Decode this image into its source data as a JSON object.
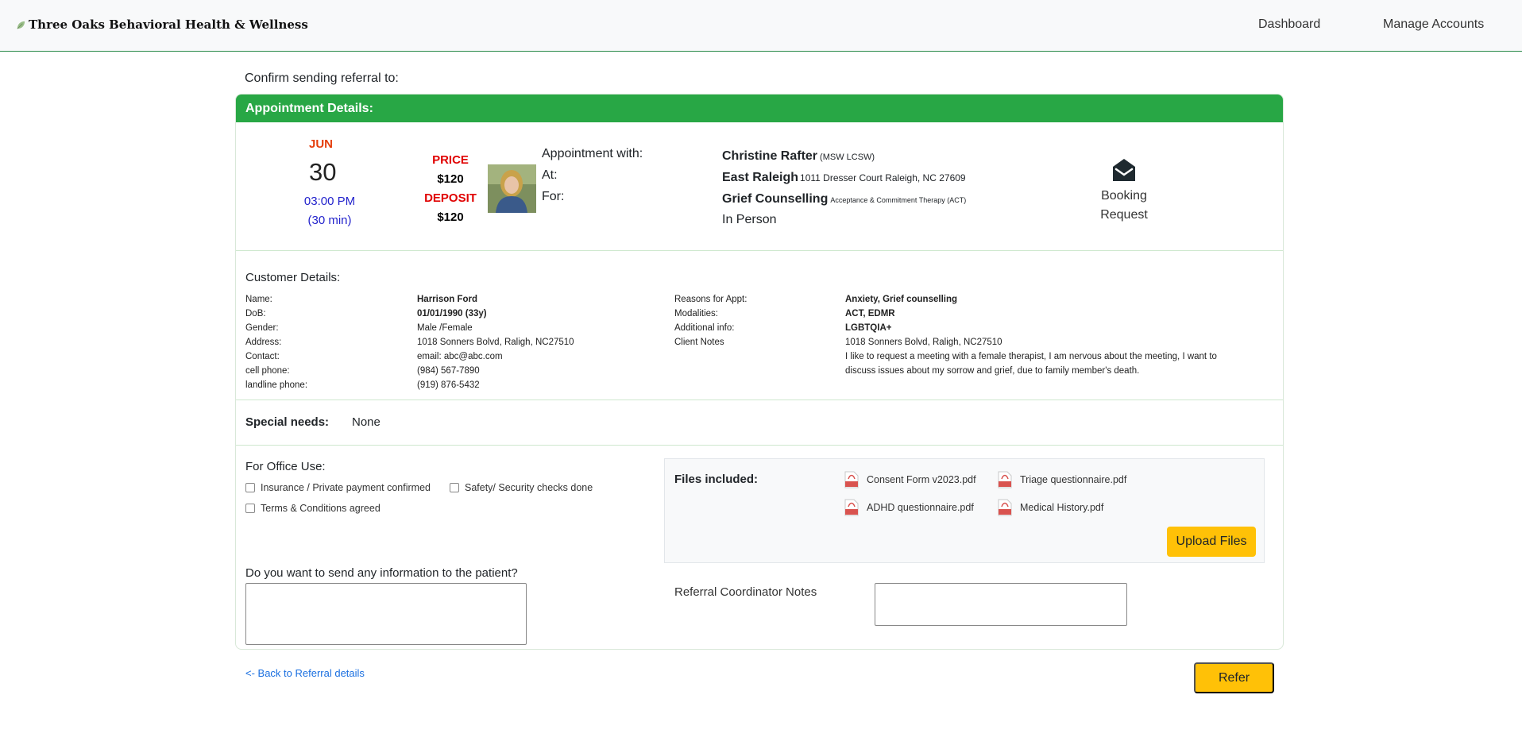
{
  "navbar": {
    "brand": "Three Oaks Behavioral Health & Wellness",
    "links": [
      "Dashboard",
      "Manage Accounts"
    ]
  },
  "page": {
    "confirm_title": "Confirm sending referral to:",
    "card_header": "Appointment Details:"
  },
  "appointment": {
    "month": "JUN",
    "day": "30",
    "time": "03:00 PM",
    "duration": "(30 min)",
    "price_label": "PRICE",
    "price": "$120",
    "deposit_label": "DEPOSIT",
    "deposit": "$120",
    "with_label": "Appointment with:",
    "at_label": "At:",
    "for_label": "For:",
    "provider_name": "Christine Rafter",
    "provider_credentials": "(MSW LCSW)",
    "location_name": "East Raleigh",
    "location_address": "1011 Dresser Court Raleigh, NC 27609",
    "service": "Grief Counselling",
    "service_detail": "Acceptance & Commitment Therapy (ACT)",
    "mode": "In Person",
    "booking_line1": "Booking",
    "booking_line2": "Request"
  },
  "customer": {
    "title": "Customer Details:",
    "left_labels": [
      "Name:",
      "DoB:",
      "Gender:",
      "Address:",
      "Contact:",
      "cell phone:",
      "landline phone:"
    ],
    "left_values": [
      "Harrison Ford",
      "01/01/1990 (33y)",
      "Male /Female",
      "1018 Sonners Bolvd, Raligh, NC27510",
      "email: abc@abc.com",
      "(984) 567-7890",
      "(919) 876-5432"
    ],
    "right_labels": [
      "Reasons for Appt:",
      "Modalities:",
      "Additional info:",
      "Client Notes"
    ],
    "right_values": [
      "Anxiety, Grief counselling",
      "ACT, EDMR",
      "LGBTQIA+",
      "1018 Sonners Bolvd, Raligh, NC27510"
    ],
    "client_note_line1": "I like to request a meeting with a female therapist, I am nervous about the meeting, I want to",
    "client_note_line2": "discuss issues about my sorrow and grief, due to family member's death."
  },
  "special_needs": {
    "label": "Special needs:",
    "value": "None"
  },
  "office": {
    "title": "For Office Use:",
    "checks": [
      "Insurance / Private payment confirmed",
      "Safety/ Security checks done",
      "Terms & Conditions agreed"
    ]
  },
  "files": {
    "title": "Files included:",
    "items": [
      "Consent Form v2023.pdf",
      "Triage questionnaire.pdf",
      "ADHD questionnaire.pdf",
      "Medical History.pdf"
    ],
    "upload_label": "Upload Files"
  },
  "messages": {
    "patient_question": "Do you want to send any information to the patient?",
    "notes_label": "Referral Coordinator Notes"
  },
  "footer": {
    "back_link": "<- Back to Referral details",
    "refer_label": "Refer"
  }
}
